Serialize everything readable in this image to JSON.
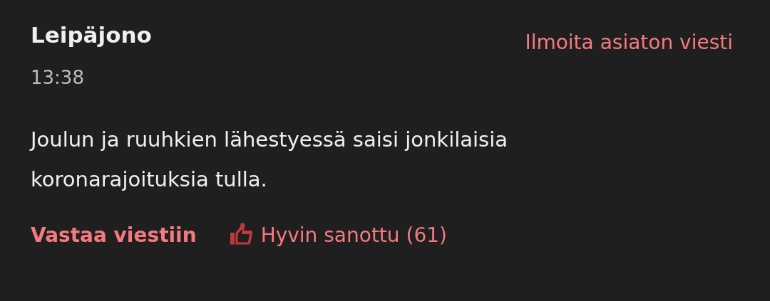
{
  "comment": {
    "author": "Leipäjono",
    "time": "13:38",
    "report_link": "Ilmoita asiaton viesti",
    "text": "Joulun ja ruuhkien lähestyessä saisi jonkilaisia koronarajoituksia tulla.",
    "reply_link": "Vastaa viestiin",
    "like_button": "Hyvin sanottu (61)"
  }
}
